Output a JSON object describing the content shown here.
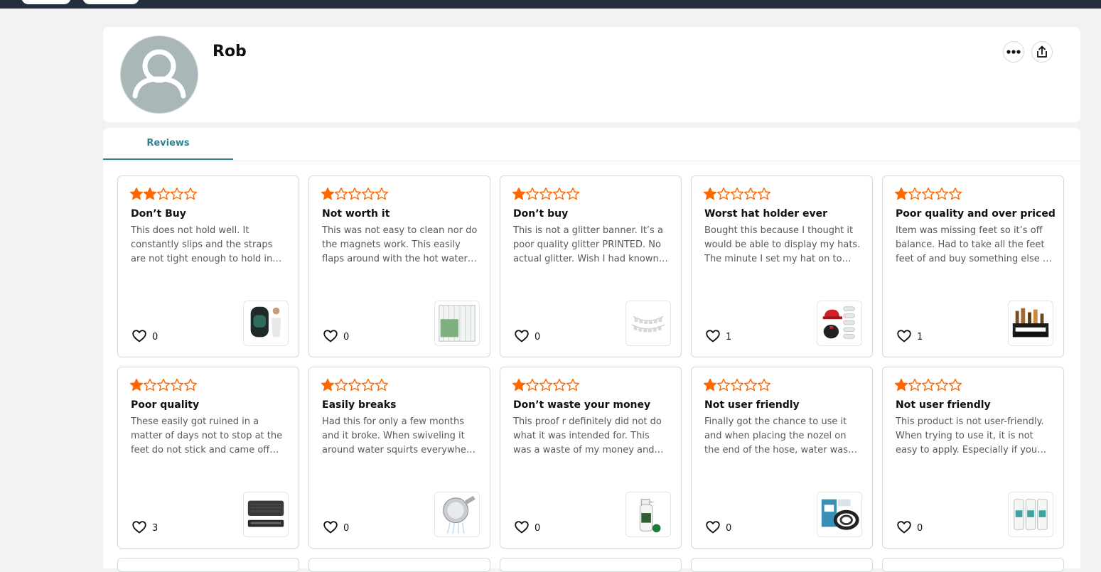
{
  "profile": {
    "name": "Rob"
  },
  "tabs": [
    {
      "label": "Reviews"
    }
  ],
  "colors": {
    "star": "#ff6600",
    "accent": "#2e8390",
    "avatar": "#aab7b8"
  },
  "reviews": [
    {
      "rating": 2,
      "title": "Don’t Buy",
      "body": "This does not hold well. It constantly slips and the straps are not tight enough to hold in…",
      "likes": "0",
      "product_icon": "seat-cushion"
    },
    {
      "rating": 1,
      "title": "Not worth it",
      "body": "This was not easy to clean nor do the magnets work. This easily flaps around with the hot water…",
      "likes": "0",
      "product_icon": "shower-curtain"
    },
    {
      "rating": 1,
      "title": "Don’t buy",
      "body": "This is not a glitter banner. It’s a poor quality glitter PRINTED. No actual glitter. Wish I had known…",
      "likes": "0",
      "product_icon": "banner"
    },
    {
      "rating": 1,
      "title": "Worst hat holder ever",
      "body": "Bought this because I thought it would be able to display my hats. The minute I set my hat on to…",
      "likes": "1",
      "product_icon": "hat-holder"
    },
    {
      "rating": 1,
      "title": "Poor quality and over priced",
      "body": "Item was missing feet so it’s off balance. Had to take all the feet feet of and buy something else …",
      "likes": "1",
      "product_icon": "shelf"
    },
    {
      "rating": 1,
      "title": "Poor quality",
      "body": "These easily got ruined in a matter of days not to stop at the feet do not stick and came off…",
      "likes": "3",
      "product_icon": "drying-mat"
    },
    {
      "rating": 1,
      "title": "Easily breaks",
      "body": "Had this for only a few months and it broke. When swiveling it around water squirts everywhe…",
      "likes": "0",
      "product_icon": "shower-head"
    },
    {
      "rating": 1,
      "title": "Don’t waste your money",
      "body": "This proof r definitely did not do what it was intended for. This was a waste of my money and time.…",
      "likes": "0",
      "product_icon": "spray-bottle"
    },
    {
      "rating": 1,
      "title": "Not user friendly",
      "body": "Finally got the chance to use it and when placing the nozel on the end of the hose, water was…",
      "likes": "0",
      "product_icon": "hose"
    },
    {
      "rating": 1,
      "title": "Not user friendly",
      "body": "This product is not user-friendly. When trying to use it, it is not easy to apply. Especially if you…",
      "likes": "0",
      "product_icon": "bottles"
    }
  ]
}
